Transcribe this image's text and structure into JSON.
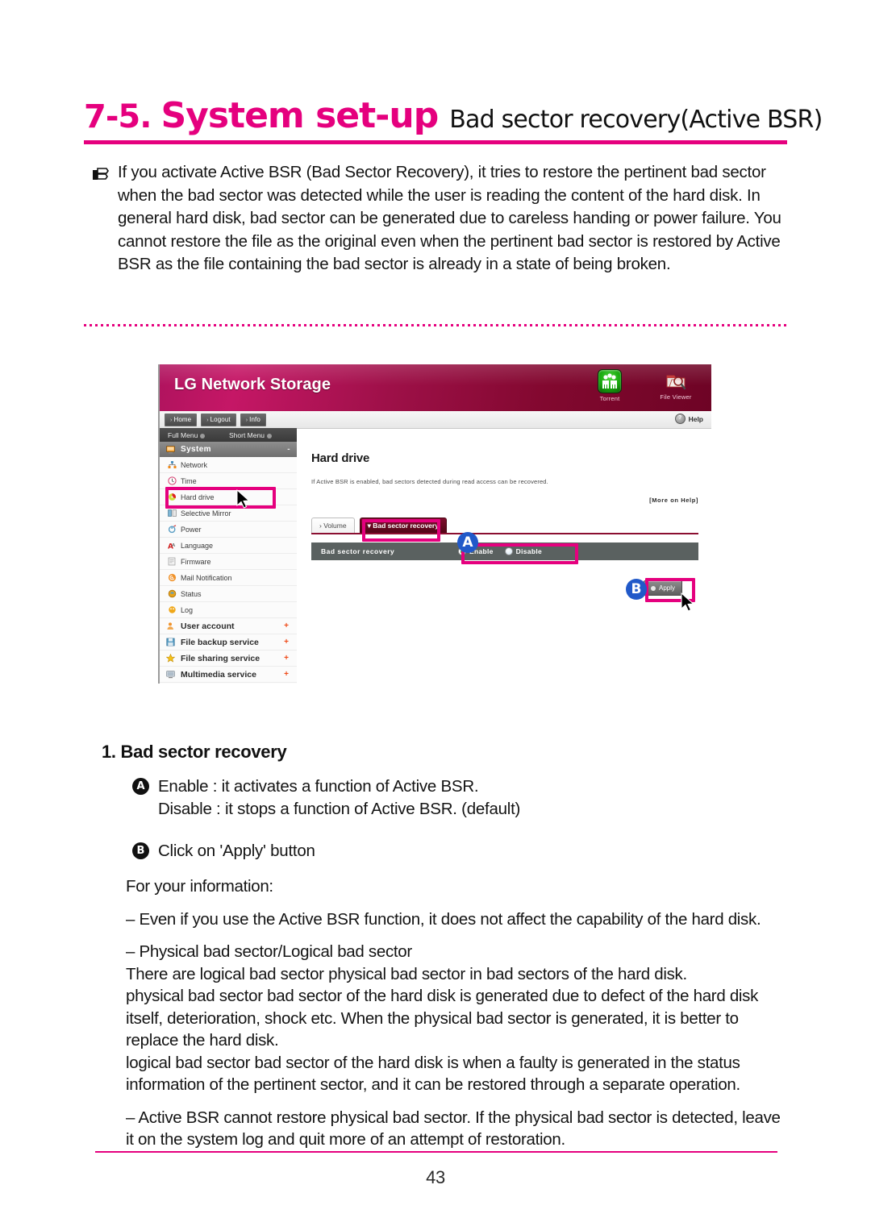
{
  "page": {
    "number": "43",
    "title_number": "7-5.",
    "title_main": "System set-up",
    "title_sub": "Bad sector recovery(Active BSR)"
  },
  "intro": {
    "icon": "note-hand-icon",
    "text": "If you activate Active BSR (Bad Sector Recovery), it tries to restore the pertinent bad sector when the bad sector was detected while the user is reading the content of the hard disk. In general hard disk, bad sector can be generated due to careless handing or power failure. You cannot restore the file as the original even when the pertinent bad sector is restored by Active BSR as the file containing the bad sector is already in a state of being broken."
  },
  "screenshot": {
    "brand_title": "LG Network Storage",
    "apps": [
      {
        "label": "Torrent",
        "icon": "torrent-icon"
      },
      {
        "label": "File Viewer",
        "icon": "file-viewer-icon"
      }
    ],
    "toolbar": {
      "buttons": [
        "Home",
        "Logout",
        "Info"
      ],
      "help_label": "Help",
      "help_icon": "help-icon"
    },
    "menu_strip": {
      "full_menu": "Full Menu",
      "short_menu": "Short Menu"
    },
    "sidebar": {
      "group": {
        "label": "System",
        "sign": "-",
        "icon": "monitor-icon"
      },
      "sub_items": [
        {
          "label": "Network",
          "icon": "network-icon"
        },
        {
          "label": "Time",
          "icon": "clock-icon"
        },
        {
          "label": "Hard drive",
          "icon": "harddrive-icon",
          "highlighted": true
        },
        {
          "label": "Selective Mirror",
          "icon": "mirror-icon"
        },
        {
          "label": "Power",
          "icon": "power-icon"
        },
        {
          "label": "Language",
          "icon": "language-icon"
        },
        {
          "label": "Firmware",
          "icon": "firmware-icon"
        },
        {
          "label": "Mail Notification",
          "icon": "mail-icon"
        },
        {
          "label": "Status",
          "icon": "status-icon"
        },
        {
          "label": "Log",
          "icon": "log-icon"
        }
      ],
      "top_items": [
        {
          "label": "User account",
          "icon": "user-icon",
          "sign": "+"
        },
        {
          "label": "File backup service",
          "icon": "backup-icon",
          "sign": "+"
        },
        {
          "label": "File sharing service",
          "icon": "star-icon",
          "sign": "+"
        },
        {
          "label": "Multimedia service",
          "icon": "multimedia-icon",
          "sign": "+"
        }
      ]
    },
    "panel": {
      "title": "Hard drive",
      "description": "If Active BSR is enabled, bad sectors detected during read access can be recovered.",
      "more_on_help": "[More on Help]",
      "tabs": [
        {
          "label": "Volume",
          "active": false
        },
        {
          "label": "Bad sector recovery",
          "active": true
        }
      ],
      "setting_row": {
        "label": "Bad sector recovery",
        "options": [
          {
            "label": "Enable",
            "selected": true
          },
          {
            "label": "Disable",
            "selected": false
          }
        ]
      },
      "apply_label": "Apply"
    },
    "annotations": {
      "badge_a": "A",
      "badge_b": "B"
    }
  },
  "section": {
    "heading": "1. Bad sector recovery",
    "items": [
      {
        "badge": "A",
        "line1": "Enable : it activates a function of Active BSR.",
        "line2": "Disable : it stops a function of Active BSR. (default)"
      },
      {
        "badge": "B",
        "line1": "Click on 'Apply' button",
        "line2": ""
      }
    ],
    "info_heading": "For your information:",
    "info_paragraphs": [
      "– Even if you use the Active BSR function, it does not affect the capability of the hard disk.",
      "– Physical bad sector/Logical bad sector",
      "There are logical bad sector physical bad sector in bad sectors of the hard disk.",
      "physical bad sector  bad sector of the hard disk is generated due to defect of the hard disk itself, deterioration, shock etc. When the physical bad sector is generated, it is better to replace the hard disk.",
      "logical bad sector bad sector of the hard disk is when a faulty is generated in the status information of the pertinent sector, and it can be restored through a separate operation.",
      "– Active BSR cannot restore physical bad sector. If the physical bad sector is detected, leave it on the system log and quit more of an attempt of restoration."
    ]
  },
  "colors": {
    "brand_pink": "#e5007e",
    "badge_blue": "#2159c9",
    "panel_row_gray": "#5a6160",
    "radio_on_green": "#14c414"
  }
}
